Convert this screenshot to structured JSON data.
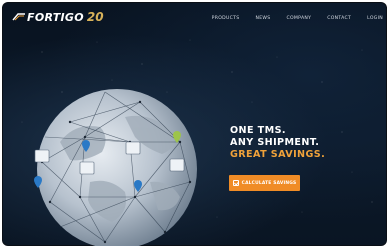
{
  "brand": {
    "name": "FORTIGO",
    "anniversary": "20"
  },
  "nav": {
    "items": [
      "PRODUCTS",
      "NEWS",
      "COMPANY",
      "CONTACT",
      "LOGIN"
    ]
  },
  "hero": {
    "line1": "ONE TMS.",
    "line2": "ANY SHIPMENT.",
    "line3": "GREAT SAVINGS.",
    "cta_label": "CALCULATE SAVINGS"
  },
  "colors": {
    "accent": "#f08c26",
    "highlight_text": "#f0a23a",
    "background": "#0c1a2b"
  },
  "icons": [
    "logo-mark-icon",
    "globe-network-icon",
    "checkbox-icon"
  ]
}
